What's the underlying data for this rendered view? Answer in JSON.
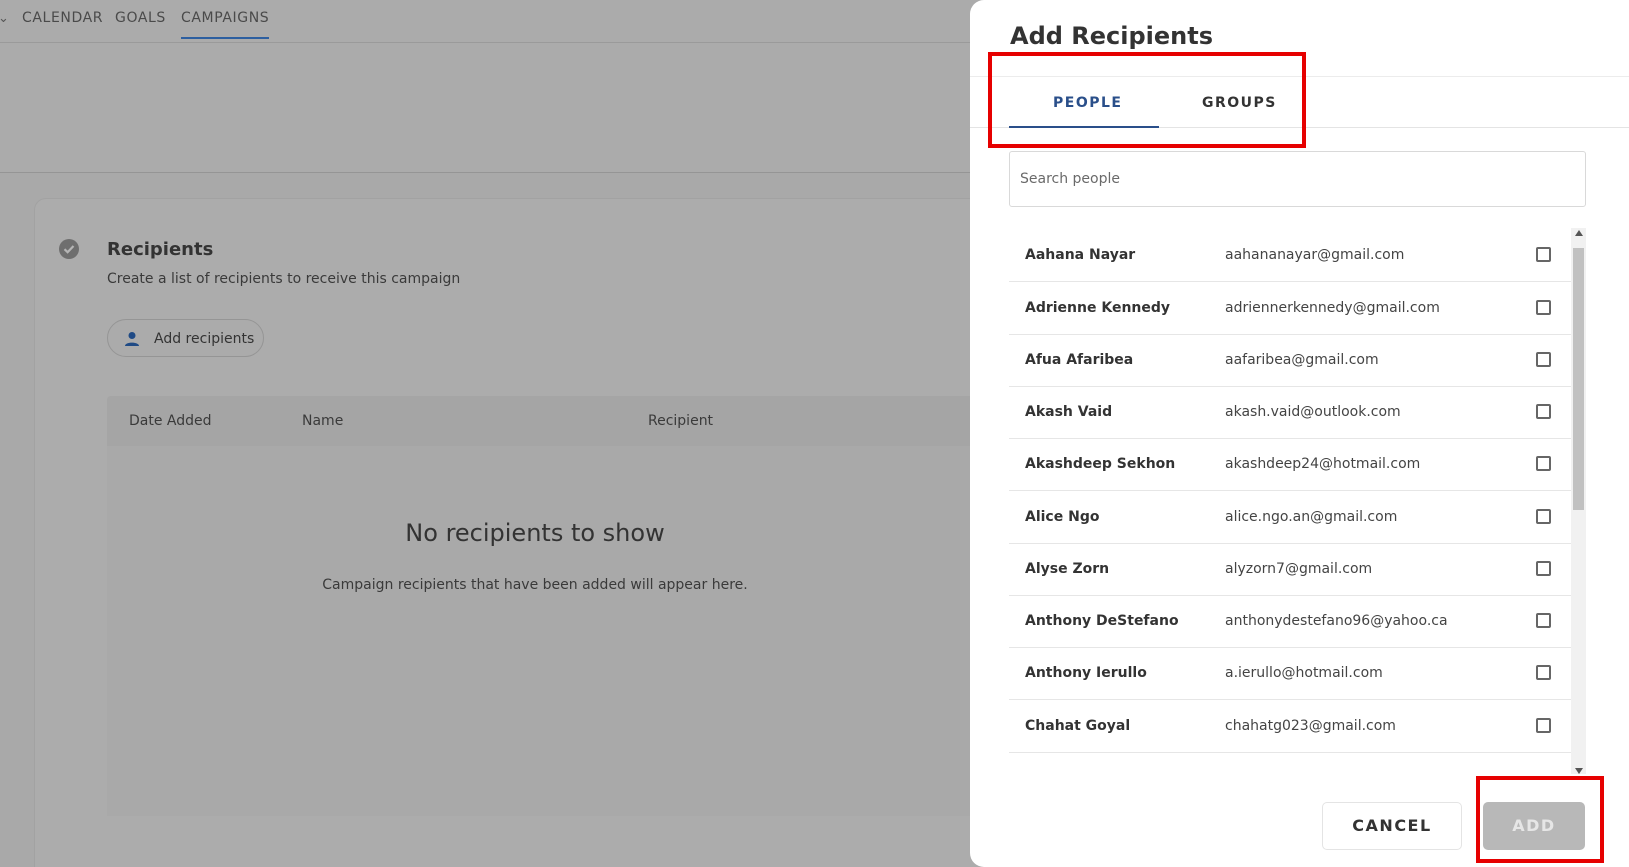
{
  "nav": {
    "items": [
      {
        "label": "CALENDAR"
      },
      {
        "label": "GOALS"
      },
      {
        "label": "CAMPAIGNS",
        "active": true
      }
    ]
  },
  "recipients_section": {
    "title": "Recipients",
    "subtitle": "Create a list of recipients to receive this campaign",
    "add_button_label": "Add recipients",
    "columns": [
      "Date Added",
      "Name",
      "Recipient"
    ],
    "empty_title": "No recipients to show",
    "empty_subtitle": "Campaign recipients that have been added will appear here."
  },
  "drawer": {
    "title": "Add Recipients",
    "tabs": [
      {
        "label": "PEOPLE",
        "active": true
      },
      {
        "label": "GROUPS",
        "active": false
      }
    ],
    "search_placeholder": "Search people",
    "people": [
      {
        "name": "Aahana Nayar",
        "email": "aahananayar@gmail.com",
        "checked": false
      },
      {
        "name": "Adrienne Kennedy",
        "email": "adriennerkennedy@gmail.com",
        "checked": false
      },
      {
        "name": "Afua Afaribea",
        "email": "aafaribea@gmail.com",
        "checked": false
      },
      {
        "name": "Akash Vaid",
        "email": "akash.vaid@outlook.com",
        "checked": false
      },
      {
        "name": "Akashdeep Sekhon",
        "email": "akashdeep24@hotmail.com",
        "checked": false
      },
      {
        "name": "Alice Ngo",
        "email": "alice.ngo.an@gmail.com",
        "checked": false
      },
      {
        "name": "Alyse Zorn",
        "email": "alyzorn7@gmail.com",
        "checked": false
      },
      {
        "name": "Anthony DeStefano",
        "email": "anthonydestefano96@yahoo.ca",
        "checked": false
      },
      {
        "name": "Anthony Ierullo",
        "email": "a.ierullo@hotmail.com",
        "checked": false
      },
      {
        "name": "Chahat Goyal",
        "email": "chahatg023@gmail.com",
        "checked": false
      }
    ],
    "cancel_label": "CANCEL",
    "add_label": "ADD"
  },
  "colors": {
    "accent": "#2a4f8a",
    "highlight": "#e60000",
    "overlay": "#a9a9a9"
  }
}
